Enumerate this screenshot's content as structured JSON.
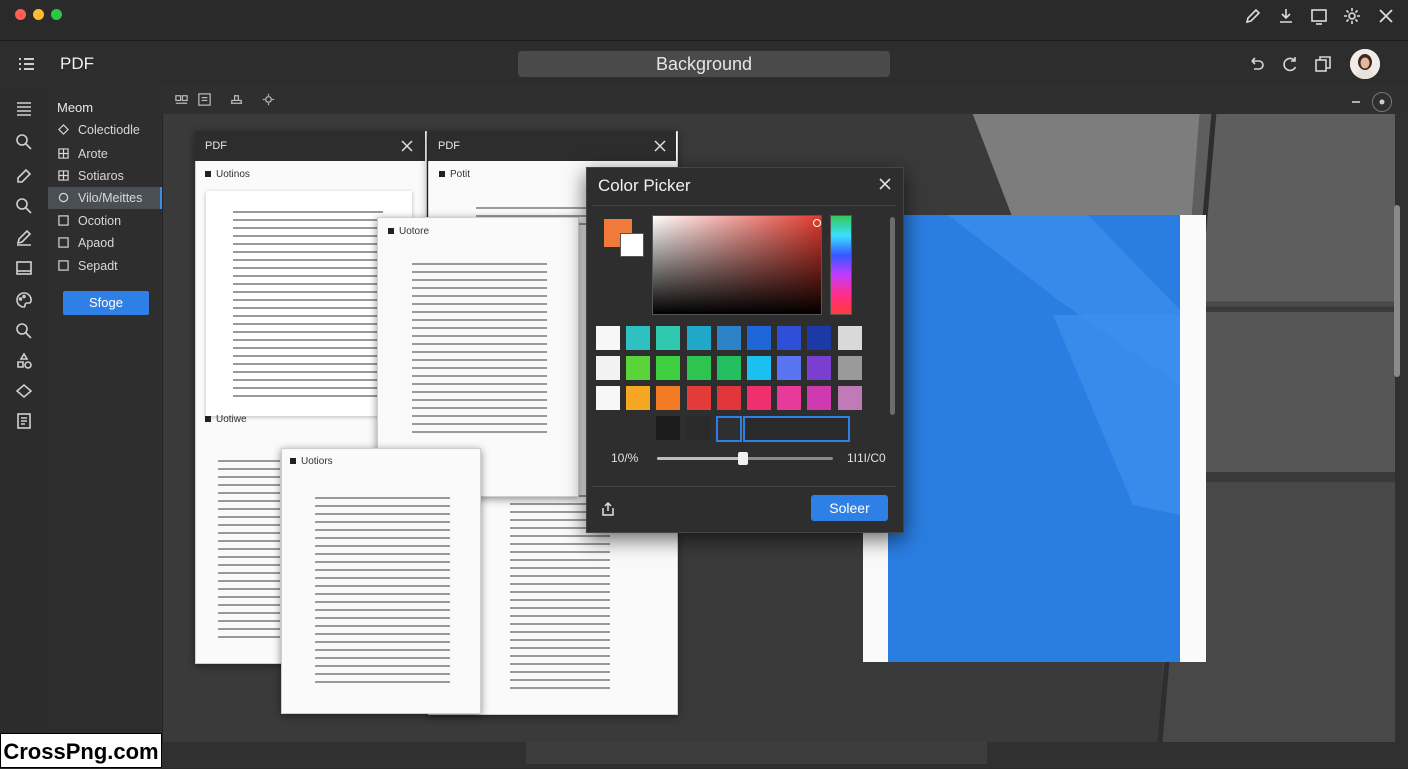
{
  "titlebar": {
    "traffic_colors": [
      "#ff5f57",
      "#febc2e",
      "#28c840"
    ],
    "icons": [
      "pencil-icon",
      "download-icon",
      "window-icon",
      "gear-icon",
      "close-icon"
    ]
  },
  "header": {
    "app_title": "PDF",
    "search_value": "Background",
    "icons": [
      "undo-icon",
      "refresh-icon",
      "duplicate-icon",
      "avatar"
    ]
  },
  "menu": {
    "title": "Meom",
    "items": [
      {
        "label": "Colectiodle",
        "icon": "diamond-icon"
      },
      {
        "label": "Arote",
        "icon": "grid-icon"
      },
      {
        "label": "Sotiaros",
        "icon": "grid-icon"
      },
      {
        "label": "Vilo/Meittes",
        "icon": "circle-icon",
        "selected": true
      },
      {
        "label": "Ocotion",
        "icon": "square-icon"
      },
      {
        "label": "Apaod",
        "icon": "square-icon"
      },
      {
        "label": "Sepadt",
        "icon": "square-icon"
      }
    ],
    "button": "Sfoge"
  },
  "docs": {
    "card1_tab": "PDF",
    "card1_label": "Uotinos",
    "card1_label2": "Uotiwe",
    "card2_tab": "PDF",
    "card2_label": "Potit",
    "card3_label": "Uotore",
    "card4_label": "Uotiors"
  },
  "picker": {
    "title": "Color Picker",
    "opacity": "10/%",
    "value": "1I1I/C0",
    "button": "Soleer",
    "swatch_rows": [
      [
        "#f7f7f7",
        "#2fc0c2",
        "#2fc9b0",
        "#1fa8c8",
        "#2d83c7",
        "#1f67d8",
        "#2f4fd8",
        "#1b3aa8",
        "#d9d9d9"
      ],
      [
        "#f2f2f2",
        "#59d43a",
        "#3fcf3f",
        "#2fc44f",
        "#24bf5f",
        "#19c0f0",
        "#5a73f0",
        "#7a3fd0",
        "#9a9a9a"
      ],
      [
        "#f7f7f7",
        "#f5a623",
        "#f27b23",
        "#e33a3a",
        "#e0353b",
        "#f0306e",
        "#e83a98",
        "#d03ab0",
        "#c07ab8"
      ],
      [
        "#1b1b1b",
        "#2a2a2a",
        "#2f2f2f",
        "#262626"
      ]
    ],
    "preview_colors": [
      "#f07a3a",
      "#ffffff"
    ]
  },
  "watermark": "CrossPng.com"
}
